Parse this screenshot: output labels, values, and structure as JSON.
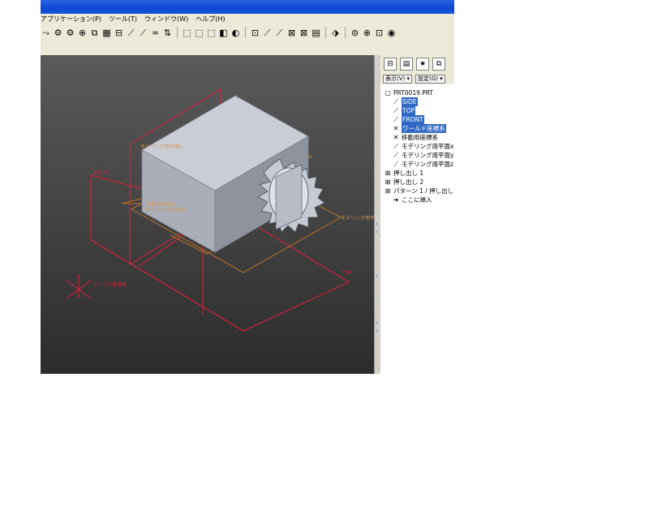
{
  "menu": [
    "アプリケーション(P)",
    "ツール(T)",
    "ウィンドウ(W)",
    "ヘルプ(H)"
  ],
  "toolbar_icons": [
    "⤳",
    "⚙",
    "⚙",
    "⊕",
    "⧉",
    "▦",
    "⊟",
    "⟋",
    "⟋",
    "≈",
    "⇅",
    "|",
    "⬚",
    "⬚",
    "⬚",
    "◧",
    "◐",
    "|",
    "⊡",
    "⟋",
    "⟋",
    "⊠",
    "⊠",
    "▤",
    "|",
    "⬗",
    "|",
    "⊜",
    "⊕",
    "⊡",
    "◉"
  ],
  "viewport": {
    "labels": {
      "right": "RIGHT",
      "top": "TOP",
      "world_csys": "ワールド座標系",
      "plane1": "モデリング用平面1",
      "plane2": "モデリング用平面2",
      "csys_move": "移動用座標系",
      "plane_right": "モデリング用平"
    }
  },
  "panel": {
    "tabs": [
      "model-tree-icon",
      "folder-icon",
      "favorites-icon",
      "layers-icon"
    ],
    "tab_glyphs": [
      "⊟",
      "▤",
      "★",
      "⧉"
    ],
    "show_button": "表示(V) ▾",
    "settings_button": "設定(G) ▾",
    "tree": [
      {
        "icon": "▢",
        "label": "PRT0019.PRT",
        "highlight": false,
        "indent": 0
      },
      {
        "icon": "⟋",
        "label": "SIDE",
        "highlight": true,
        "indent": 1
      },
      {
        "icon": "⟋",
        "label": "TOP",
        "highlight": true,
        "indent": 1
      },
      {
        "icon": "⟋",
        "label": "FRONT",
        "highlight": true,
        "indent": 1
      },
      {
        "icon": "✕",
        "label": "ワールド座標系",
        "highlight": true,
        "indent": 1
      },
      {
        "icon": "✕",
        "label": "移動用座標系",
        "highlight": false,
        "indent": 1
      },
      {
        "icon": "⟋",
        "label": "モデリング用平面x",
        "highlight": false,
        "indent": 1
      },
      {
        "icon": "⟋",
        "label": "モデリング用平面y",
        "highlight": false,
        "indent": 1
      },
      {
        "icon": "⟋",
        "label": "モデリング用平面z",
        "highlight": false,
        "indent": 1
      },
      {
        "icon": "⊞",
        "label": "押し出し 1",
        "highlight": false,
        "indent": 0
      },
      {
        "icon": "⊞",
        "label": "押し出し 2",
        "highlight": false,
        "indent": 0
      },
      {
        "icon": "⊞",
        "label": "パターン 1 / 押し出し",
        "highlight": false,
        "indent": 0
      },
      {
        "icon": "➜",
        "label": "ここに挿入",
        "highlight": false,
        "indent": 1
      }
    ]
  },
  "colors": {
    "datum_red": "#e0203a",
    "datum_orange": "#b8742a",
    "box_top": "#c9cdd6",
    "box_front": "#a9aeb8",
    "box_side": "#8e939d"
  }
}
